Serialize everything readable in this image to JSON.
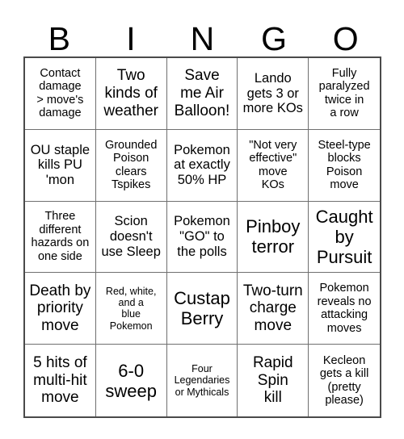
{
  "card": {
    "title": "BINGO",
    "header_letters": [
      "B",
      "I",
      "N",
      "G",
      "O"
    ],
    "columns": 5,
    "rows": 5,
    "colors": {
      "background": "#ffffff",
      "text": "#000000",
      "outer_border": "#4a4a4a",
      "inner_border": "#6f6f6f"
    },
    "cells": [
      {
        "text": "Contact\ndamage\n> move's\ndamage",
        "size": "s"
      },
      {
        "text": "Two\nkinds of\nweather",
        "size": "l"
      },
      {
        "text": "Save\nme Air\nBalloon!",
        "size": "l"
      },
      {
        "text": "Lando\ngets 3 or\nmore KOs",
        "size": "m"
      },
      {
        "text": "Fully\nparalyzed\ntwice in\na row",
        "size": "s"
      },
      {
        "text": "OU staple\nkills PU\n'mon",
        "size": "m"
      },
      {
        "text": "Grounded\nPoison\nclears\nTspikes",
        "size": "s"
      },
      {
        "text": "Pokemon\nat exactly\n50% HP",
        "size": "m"
      },
      {
        "text": "\"Not very\neffective\"\nmove\nKOs",
        "size": "s"
      },
      {
        "text": "Steel-type\nblocks\nPoison\nmove",
        "size": "s"
      },
      {
        "text": "Three\ndifferent\nhazards on\none side",
        "size": "s"
      },
      {
        "text": "Scion\ndoesn't\nuse Sleep",
        "size": "m"
      },
      {
        "text": "Pokemon\n\"GO\" to\nthe polls",
        "size": "m"
      },
      {
        "text": "Pinboy\nterror",
        "size": "xl"
      },
      {
        "text": "Caught\nby\nPursuit",
        "size": "xl"
      },
      {
        "text": "Death by\npriority\nmove",
        "size": "l"
      },
      {
        "text": "Red, white,\nand a\nblue\nPokemon",
        "size": "xs"
      },
      {
        "text": "Custap\nBerry",
        "size": "xl"
      },
      {
        "text": "Two-turn\ncharge\nmove",
        "size": "l"
      },
      {
        "text": "Pokemon\nreveals no\nattacking\nmoves",
        "size": "s"
      },
      {
        "text": "5 hits of\nmulti-hit\nmove",
        "size": "l"
      },
      {
        "text": "6-0\nsweep",
        "size": "xl"
      },
      {
        "text": "Four\nLegendaries\nor Mythicals",
        "size": "xs"
      },
      {
        "text": "Rapid\nSpin\nkill",
        "size": "l"
      },
      {
        "text": "Kecleon\ngets a kill\n(pretty\nplease)",
        "size": "s"
      }
    ]
  }
}
